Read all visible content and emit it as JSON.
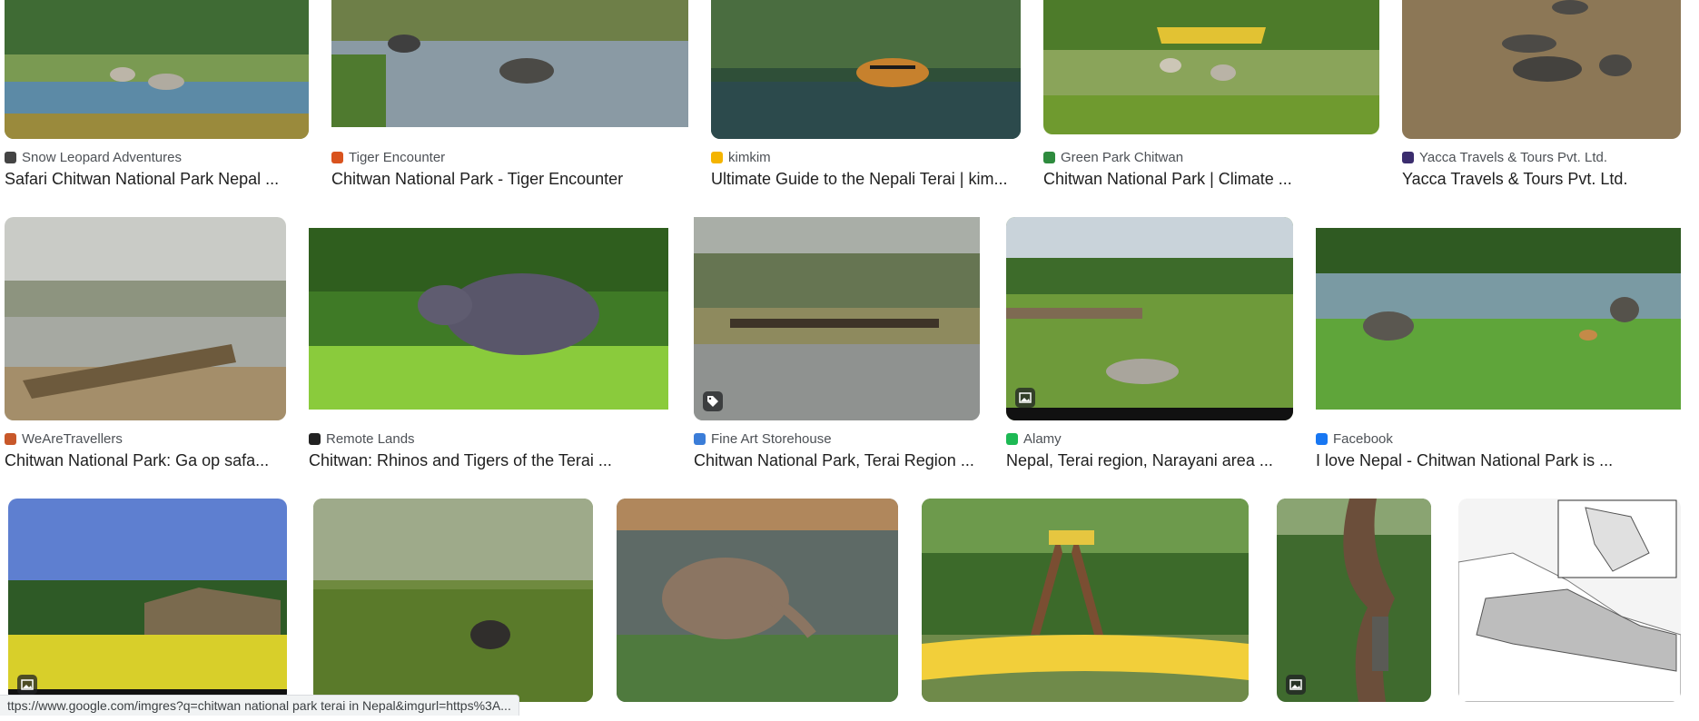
{
  "results": [
    {
      "source": "Snow Leopard Adventures",
      "title": "Safari Chitwan National Park Nepal ...",
      "favicon_color": "#444444"
    },
    {
      "source": "Tiger Encounter",
      "title": "Chitwan National Park - Tiger Encounter",
      "favicon_color": "#d9531e"
    },
    {
      "source": "kimkim",
      "title": "Ultimate Guide to the Nepali Terai | kim...",
      "favicon_color": "#f4b400"
    },
    {
      "source": "Green Park Chitwan",
      "title": "Chitwan National Park | Climate ...",
      "favicon_color": "#2e8b3e"
    },
    {
      "source": "Yacca Travels & Tours Pvt. Ltd.",
      "title": "Yacca Travels & Tours Pvt. Ltd.",
      "favicon_color": "#3b2d6e"
    },
    {
      "source": "WeAreTravellers",
      "title": "Chitwan National Park: Ga op safa...",
      "favicon_color": "#c8582a"
    },
    {
      "source": "Remote Lands",
      "title": "Chitwan: Rhinos and Tigers of the Terai ...",
      "favicon_color": "#222222"
    },
    {
      "source": "Fine Art Storehouse",
      "title": "Chitwan National Park, Terai Region ...",
      "favicon_color": "#3b7dd8"
    },
    {
      "source": "Alamy",
      "title": "Nepal, Terai region, Narayani area ...",
      "favicon_color": "#1db954"
    },
    {
      "source": "Facebook",
      "title": "I love Nepal - Chitwan National Park is ...",
      "favicon_color": "#1877f2"
    },
    {
      "source": "",
      "title": "",
      "favicon_color": "#ffffff"
    },
    {
      "source": "",
      "title": "",
      "favicon_color": "#ffffff"
    },
    {
      "source": "",
      "title": "",
      "favicon_color": "#ffffff"
    },
    {
      "source": "",
      "title": "",
      "favicon_color": "#ffffff"
    },
    {
      "source": "",
      "title": "",
      "favicon_color": "#ffffff"
    },
    {
      "source": "",
      "title": "",
      "favicon_color": "#ffffff"
    }
  ],
  "status_bar": {
    "url": "ttps://www.google.com/imgres?q=chitwan national park terai in Nepal&imgurl=https%3A..."
  }
}
